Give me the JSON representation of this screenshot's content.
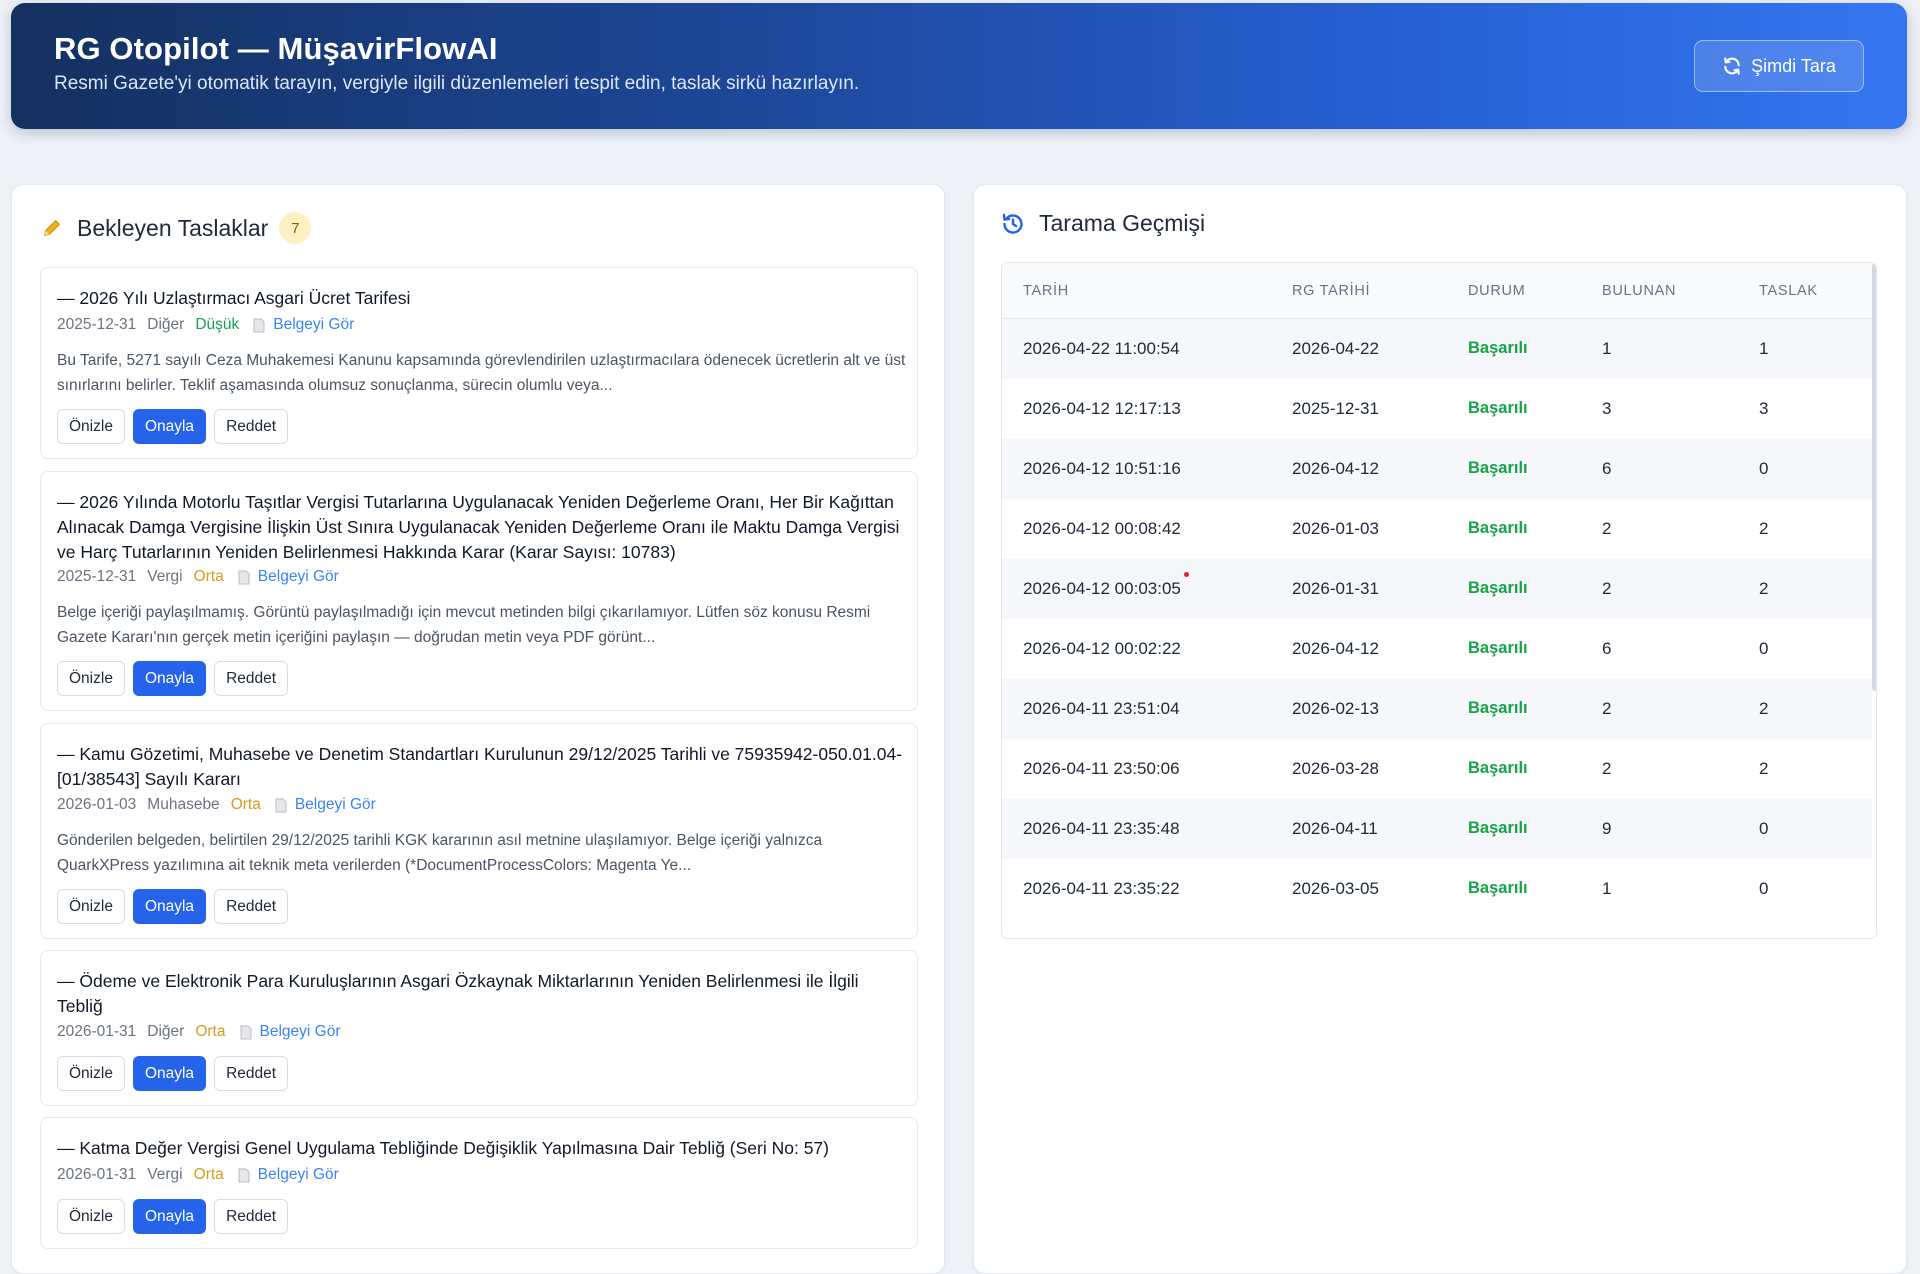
{
  "header": {
    "title": "RG Otopilot — MüşavirFlowAI",
    "subtitle": "Resmi Gazete'yi otomatik tarayın, vergiyle ilgili düzenlemeleri tespit edin, taslak sirkü hazırlayın.",
    "scan_button": "Şimdi Tara"
  },
  "pending": {
    "title": "Bekleyen Taslaklar",
    "count": "7",
    "doc_link_label": "Belgeyi Gör",
    "buttons": {
      "preview": "Önizle",
      "approve": "Onayla",
      "reject": "Reddet"
    },
    "items": [
      {
        "title": "— 2026 Yılı Uzlaştırmacı Asgari Ücret Tarifesi",
        "date": "2025-12-31",
        "category": "Diğer",
        "priority": "Düşük",
        "description": "Bu Tarife, 5271 sayılı Ceza Muhakemesi Kanunu kapsamında görevlendirilen uzlaştırmacılara ödenecek ücretlerin alt ve üst sınırlarını belirler. Teklif aşamasında olumsuz sonuçlanma, sürecin olumlu veya..."
      },
      {
        "title": "— 2026 Yılında Motorlu Taşıtlar Vergisi Tutarlarına Uygulanacak Yeniden Değerleme Oranı, Her Bir Kağıttan Alınacak Damga Vergisine İlişkin Üst Sınıra Uygulanacak Yeniden Değerleme Oranı ile Maktu Damga Vergisi ve Harç Tutarlarının Yeniden Belirlenmesi Hakkında Karar (Karar Sayısı: 10783)",
        "date": "2025-12-31",
        "category": "Vergi",
        "priority": "Orta",
        "description": "Belge içeriği paylaşılmamış. Görüntü paylaşılmadığı için mevcut metinden bilgi çıkarılamıyor. Lütfen söz konusu Resmi Gazete Kararı'nın gerçek metin içeriğini paylaşın — doğrudan metin veya PDF görünt..."
      },
      {
        "title": "— Kamu Gözetimi, Muhasebe ve Denetim Standartları Kurulunun 29/12/2025 Tarihli ve 75935942-050.01.04-[01/38543] Sayılı Kararı",
        "date": "2026-01-03",
        "category": "Muhasebe",
        "priority": "Orta",
        "description": "Gönderilen belgeden, belirtilen 29/12/2025 tarihli KGK kararının asıl metnine ulaşılamıyor. Belge içeriği yalnızca QuarkXPress yazılımına ait teknik meta verilerden (*DocumentProcessColors: Magenta Ye..."
      },
      {
        "title": "— Ödeme ve Elektronik Para Kuruluşlarının Asgari Özkaynak Miktarlarının Yeniden Belirlenmesi ile İlgili Tebliğ",
        "date": "2026-01-31",
        "category": "Diğer",
        "priority": "Orta",
        "description": ""
      },
      {
        "title": "— Katma Değer Vergisi Genel Uygulama Tebliğinde Değişiklik Yapılmasına Dair Tebliğ (Seri No: 57)",
        "date": "2026-01-31",
        "category": "Vergi",
        "priority": "Orta",
        "description": ""
      }
    ]
  },
  "history": {
    "title": "Tarama Geçmişi",
    "columns": [
      "TARİH",
      "RG TARİHİ",
      "DURUM",
      "BULUNAN",
      "TASLAK"
    ],
    "rows": [
      [
        "2026-04-22 11:00:54",
        "2026-04-22",
        "Başarılı",
        "1",
        "1"
      ],
      [
        "2026-04-12 12:17:13",
        "2025-12-31",
        "Başarılı",
        "3",
        "3"
      ],
      [
        "2026-04-12 10:51:16",
        "2026-04-12",
        "Başarılı",
        "6",
        "0"
      ],
      [
        "2026-04-12 00:08:42",
        "2026-01-03",
        "Başarılı",
        "2",
        "2"
      ],
      [
        "2026-04-12 00:03:05",
        "2026-01-31",
        "Başarılı",
        "2",
        "2"
      ],
      [
        "2026-04-12 00:02:22",
        "2026-04-12",
        "Başarılı",
        "6",
        "0"
      ],
      [
        "2026-04-11 23:51:04",
        "2026-02-13",
        "Başarılı",
        "2",
        "2"
      ],
      [
        "2026-04-11 23:50:06",
        "2026-03-28",
        "Başarılı",
        "2",
        "2"
      ],
      [
        "2026-04-11 23:35:48",
        "2026-04-11",
        "Başarılı",
        "9",
        "0"
      ],
      [
        "2026-04-11 23:35:22",
        "2026-03-05",
        "Başarılı",
        "1",
        "0"
      ]
    ]
  },
  "colors": {
    "header_start": "#14305f",
    "header_end": "#3576f0",
    "primary": "#2563eb",
    "success": "#16a34a",
    "priority_medium": "#d99a1a",
    "badge_bg": "#fdf1c3"
  },
  "icons": [
    "refresh-icon",
    "pencil-icon",
    "history-icon",
    "document-icon"
  ]
}
